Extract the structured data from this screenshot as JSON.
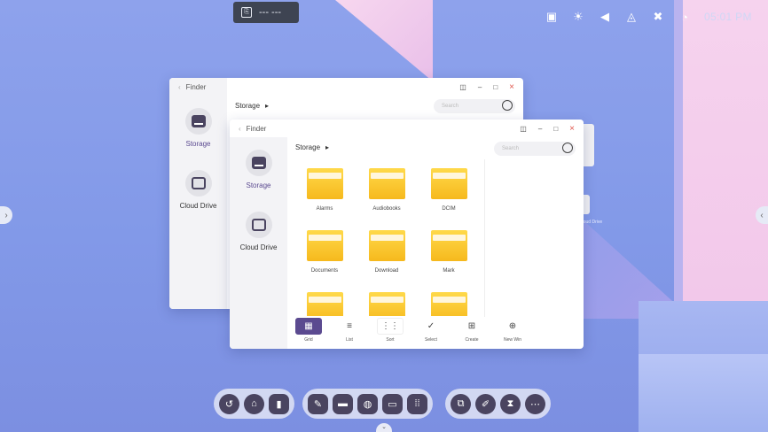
{
  "top_chip": {
    "text": "--- ---"
  },
  "status_bar": {
    "time": "05:01 PM"
  },
  "window_back": {
    "title": "Finder",
    "path": "Storage",
    "search_placeholder": "Search",
    "sidebar": [
      {
        "label": "Storage"
      },
      {
        "label": "Cloud Drive"
      }
    ]
  },
  "window_front": {
    "title": "Finder",
    "path": "Storage",
    "search_placeholder": "Search",
    "sidebar": [
      {
        "label": "Storage"
      },
      {
        "label": "Cloud Drive"
      }
    ],
    "folders": [
      {
        "name": "Alarms"
      },
      {
        "name": "Audiobooks"
      },
      {
        "name": "DCIM"
      },
      {
        "name": "Documents"
      },
      {
        "name": "Download"
      },
      {
        "name": "Mark"
      },
      {
        "name": ""
      },
      {
        "name": ""
      },
      {
        "name": ""
      }
    ],
    "toolbar": [
      {
        "label": "Grid"
      },
      {
        "label": "List"
      },
      {
        "label": "Sort"
      },
      {
        "label": "Select"
      },
      {
        "label": "Create"
      },
      {
        "label": "New Win"
      }
    ]
  },
  "behind_label": "Cloud Drive",
  "colors": {
    "accent": "#5b4a90",
    "folder": "#f6b91d",
    "close": "#e0564c",
    "dock_icon": "#4a4460"
  }
}
